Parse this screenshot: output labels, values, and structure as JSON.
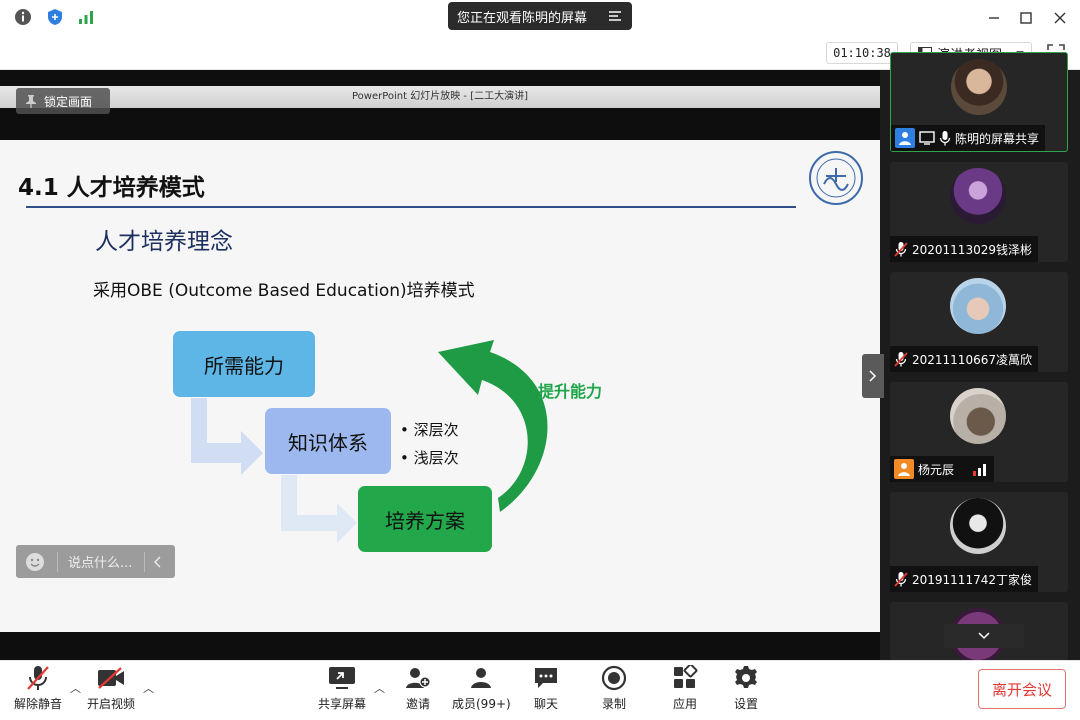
{
  "banner": {
    "text": "您正在观看陈明的屏幕"
  },
  "toolbar": {
    "timer": "01:10:38",
    "view_label": "演讲者视图"
  },
  "presentation": {
    "window_title": "PowerPoint 幻灯片放映 - [二工大演讲]",
    "lock_label": "锁定画面",
    "slide": {
      "title": "4.1 人才培养模式",
      "subtitle": "人才培养理念",
      "body": "采用OBE (Outcome Based Education)培养模式",
      "box1": "所需能力",
      "box2": "知识体系",
      "box3": "培养方案",
      "bullet1": "深层次",
      "bullet2": "浅层次",
      "arrow_label": "提升能力"
    },
    "chat_placeholder": "说点什么..."
  },
  "participants": [
    {
      "name": "陈明的屏幕共享",
      "state": "presenter"
    },
    {
      "name": "20201113029钱泽彬",
      "state": "muted"
    },
    {
      "name": "20211110667凌萬欣",
      "state": "muted"
    },
    {
      "name": "杨元辰",
      "state": "signal"
    },
    {
      "name": "20191111742丁家俊",
      "state": "muted"
    }
  ],
  "bottom": {
    "unmute": "解除静音",
    "video": "开启视频",
    "share": "共享屏幕",
    "invite": "邀请",
    "members": "成员(99+)",
    "chat": "聊天",
    "record": "录制",
    "apps": "应用",
    "settings": "设置",
    "leave": "离开会议"
  },
  "colors": {
    "accent_green": "#1fa64a",
    "leave_red": "#e53935",
    "presenter_blue": "#2f7fe0"
  }
}
